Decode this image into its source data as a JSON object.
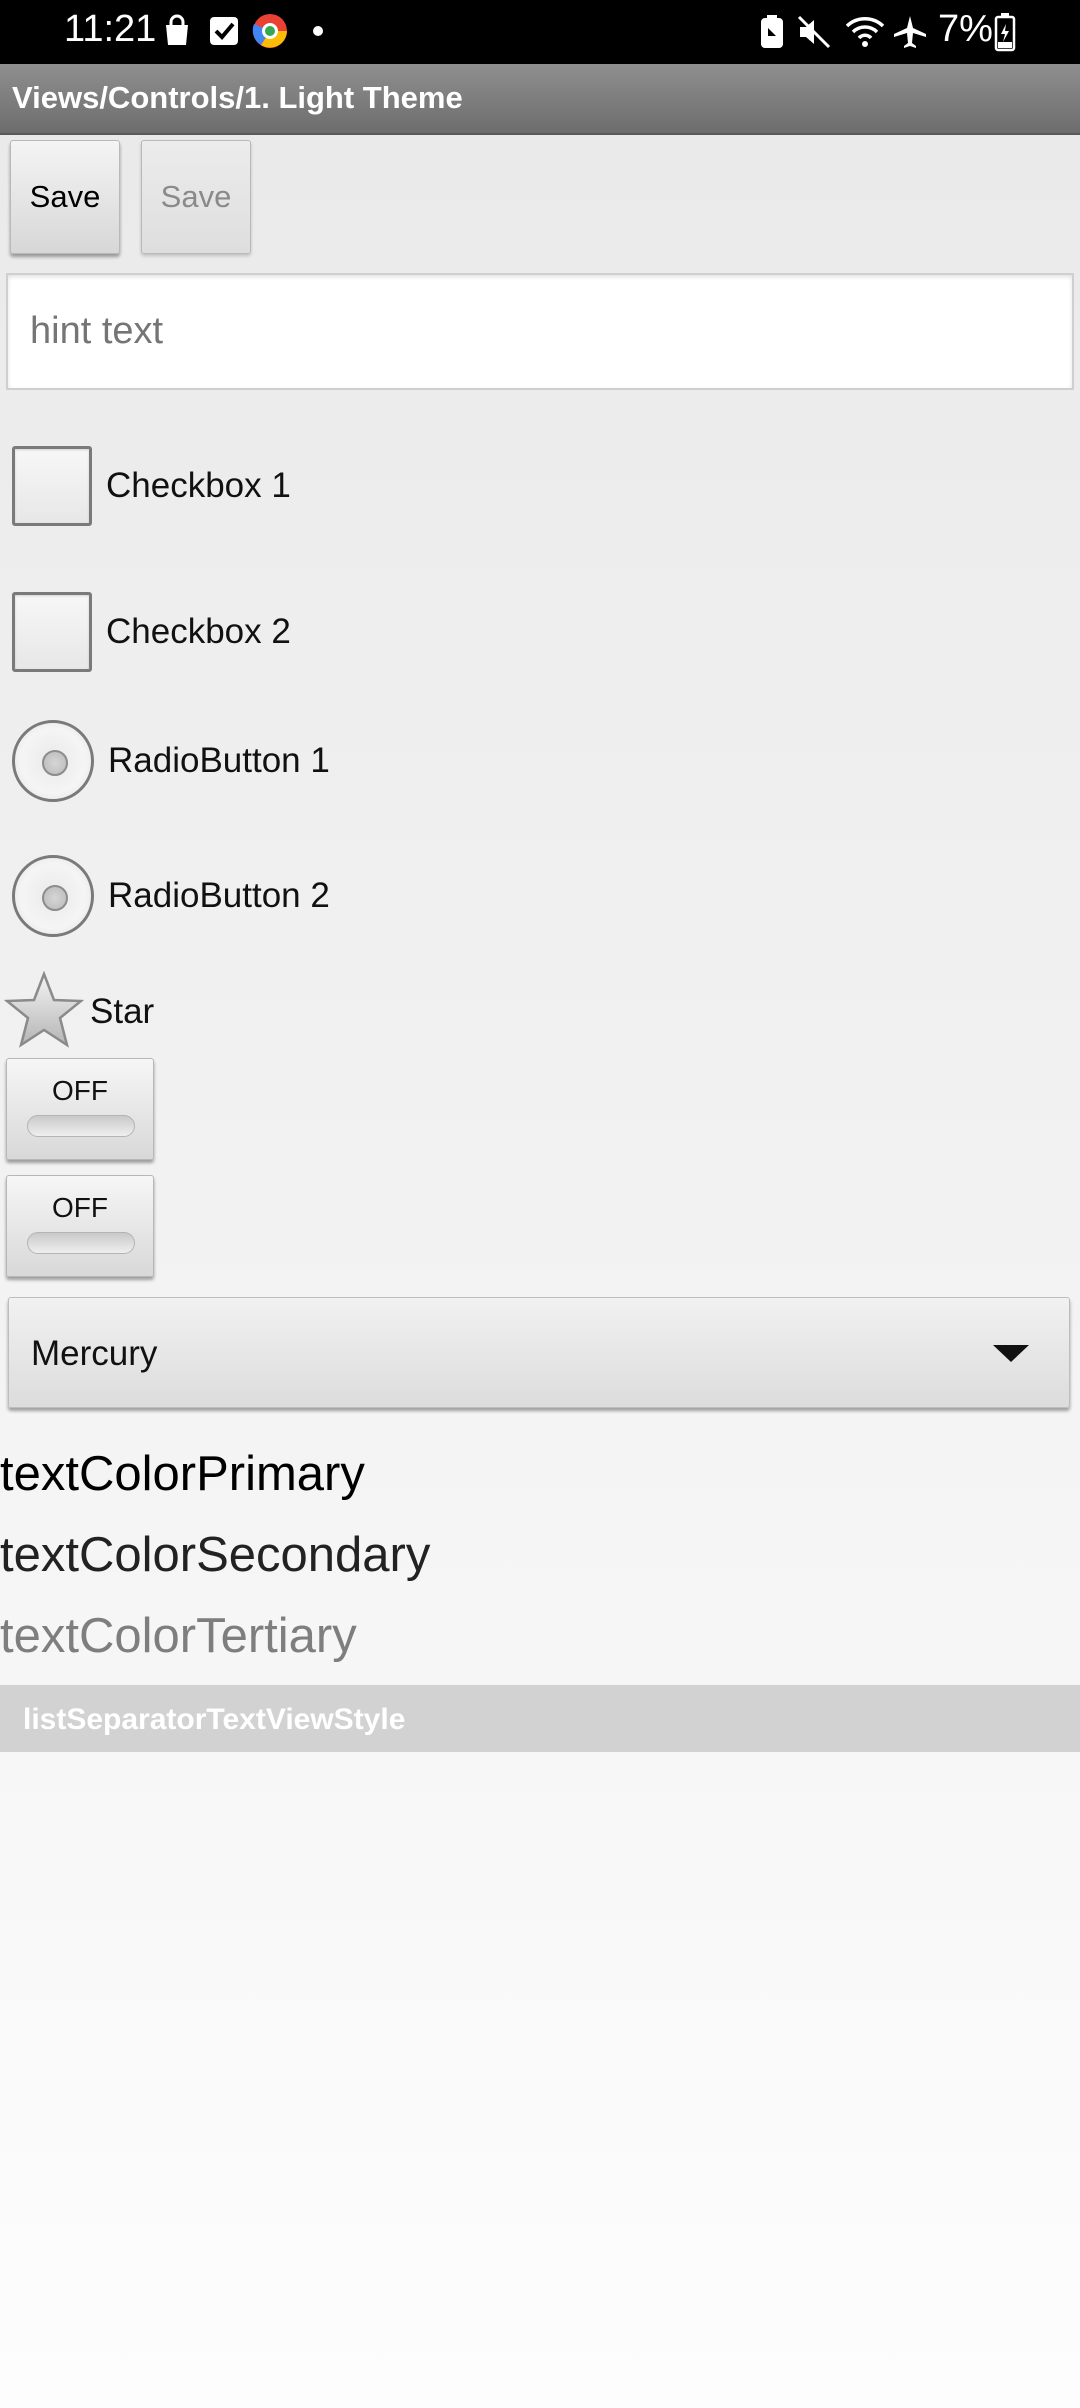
{
  "status_bar": {
    "time": "11:21",
    "battery_percent": "7%",
    "icons": [
      "shopping-bag-icon",
      "checkbox-icon",
      "browser-logo-icon",
      "dot-icon",
      "battery-saver-icon",
      "mute-icon",
      "wifi-icon",
      "airplane-icon",
      "battery-icon"
    ]
  },
  "title_bar": {
    "title": "Views/Controls/1. Light Theme"
  },
  "buttons": {
    "save_label": "Save",
    "save_disabled_label": "Save"
  },
  "edit_text": {
    "placeholder": "hint text",
    "value": ""
  },
  "checkboxes": [
    {
      "label": "Checkbox 1",
      "checked": false
    },
    {
      "label": "Checkbox 2",
      "checked": false
    }
  ],
  "radios": [
    {
      "label": "RadioButton 1",
      "selected": false
    },
    {
      "label": "RadioButton 2",
      "selected": false
    }
  ],
  "star": {
    "label": "Star",
    "checked": false
  },
  "toggles": [
    {
      "label": "OFF",
      "on": false
    },
    {
      "label": "OFF",
      "on": false
    }
  ],
  "spinner": {
    "selected": "Mercury"
  },
  "text_colors": {
    "primary": "textColorPrimary",
    "secondary": "textColorSecondary",
    "tertiary": "textColorTertiary"
  },
  "list_separator": {
    "label": "listSeparatorTextViewStyle"
  },
  "colors": {
    "title_bar": "#7d7d7d",
    "separator": "#d2d2d2",
    "tertiary_text": "#7e7e7e",
    "hint_text": "#8d8d8d"
  }
}
